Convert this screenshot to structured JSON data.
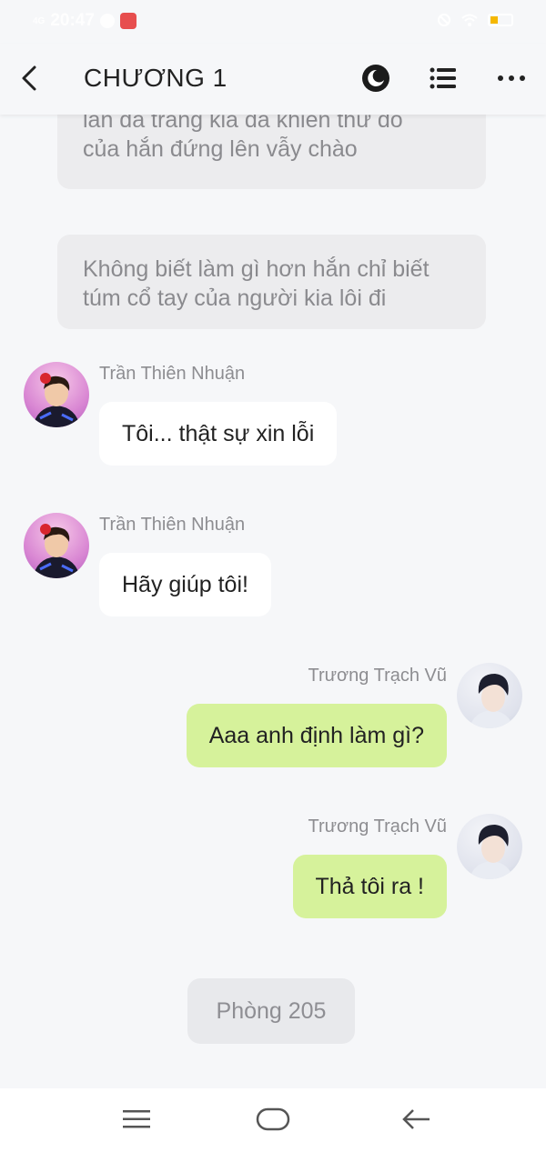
{
  "status_bar": {
    "network": "4G",
    "time": "20:47",
    "battery_color": "#f5b800"
  },
  "header": {
    "title": "CHƯƠNG 1",
    "icons": [
      "back-arrow-icon",
      "night-mode-icon",
      "chapter-list-icon",
      "more-icon"
    ]
  },
  "narration": [
    {
      "line1": "làn da trắng kia đã khiến thứ đó",
      "line2": "của hắn đứng lên vẫy chào"
    },
    {
      "line1": "Không biết làm gì hơn hắn chỉ biết",
      "line2": "túm cổ tay của người kia lôi đi"
    }
  ],
  "messages": [
    {
      "speaker": "Trần Thiên Nhuận",
      "text": "Tôi... thật sự xin lỗi",
      "side": "left"
    },
    {
      "speaker": "Trần Thiên Nhuận",
      "text": "Hãy giúp tôi!",
      "side": "left"
    },
    {
      "speaker": "Trương Trạch Vũ",
      "text": "Aaa anh định làm gì?",
      "side": "right"
    },
    {
      "speaker": "Trương Trạch Vũ",
      "text": "Thả tôi ra !",
      "side": "right"
    }
  ],
  "scene_label": "Phòng 205",
  "colors": {
    "background": "#f6f7f9",
    "left_bubble": "#ffffff",
    "right_bubble": "#d6f29b",
    "narration_bubble": "#ececee"
  },
  "navigation": [
    "menu-icon",
    "home-icon",
    "back-icon"
  ]
}
